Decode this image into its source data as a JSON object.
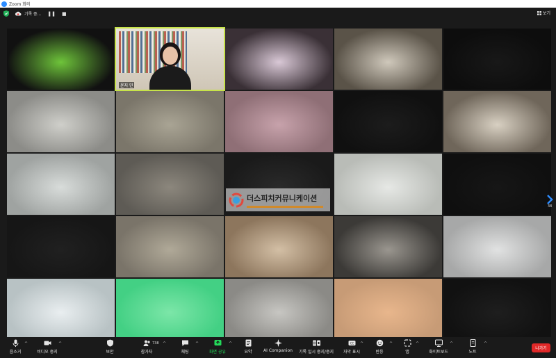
{
  "window": {
    "title": "Zoom 회의"
  },
  "topbar": {
    "recording_label": "기록 중...",
    "pause_glyph": "❚❚",
    "stop_glyph": "■",
    "view_label": "보기"
  },
  "participants": [
    {
      "name": "",
      "bg": "#111111",
      "accent": "#6ec43a"
    },
    {
      "name": "윤지 민",
      "bg": "#d6d1c7",
      "accent": "#1b1b1b",
      "speaker": true
    },
    {
      "name": "",
      "bg": "#3a3036",
      "accent": "#d9c8d6"
    },
    {
      "name": "",
      "bg": "#5a5348",
      "accent": "#cfc8bb"
    },
    {
      "name": "",
      "bg": "#0d0d0d",
      "accent": "#181818"
    },
    {
      "name": "",
      "bg": "#8c8c88",
      "accent": "#cfcfca"
    },
    {
      "name": "",
      "bg": "#7b766a",
      "accent": "#a9a494"
    },
    {
      "name": "",
      "bg": "#8f6f76",
      "accent": "#c7a2ab"
    },
    {
      "name": "",
      "bg": "#101010",
      "accent": "#1c1c1c"
    },
    {
      "name": "",
      "bg": "#6f665a",
      "accent": "#d8d0c2"
    },
    {
      "name": "",
      "bg": "#9fa3a1",
      "accent": "#d8dcda"
    },
    {
      "name": "",
      "bg": "#5e5b55",
      "accent": "#8c877d"
    },
    {
      "name": "",
      "bg": "#1a1a1a",
      "accent": "#2a2a2a"
    },
    {
      "name": "",
      "bg": "#b9bcb7",
      "accent": "#e6e8e5"
    },
    {
      "name": "",
      "bg": "#0f0f0f",
      "accent": "#161616"
    },
    {
      "name": "",
      "bg": "#161616",
      "accent": "#202020"
    },
    {
      "name": "",
      "bg": "#7a7469",
      "accent": "#b0a998"
    },
    {
      "name": "",
      "bg": "#8d765d",
      "accent": "#d3bfa5"
    },
    {
      "name": "",
      "bg": "#3c3a37",
      "accent": "#9a968f"
    },
    {
      "name": "",
      "bg": "#a7a8a8",
      "accent": "#e1e2e2"
    },
    {
      "name": "",
      "bg": "#b8c2c4",
      "accent": "#e9eef0"
    },
    {
      "name": "",
      "bg": "#43d084",
      "accent": "#7ce6a8"
    },
    {
      "name": "",
      "bg": "#8b8a86",
      "accent": "#c7c6c2"
    },
    {
      "name": "",
      "bg": "#c79b76",
      "accent": "#e8b68c"
    },
    {
      "name": "",
      "bg": "#111111",
      "accent": "#1e1e1e"
    }
  ],
  "watermark": {
    "text": "더스피치커뮤니케이션"
  },
  "side_page": {
    "count": "38"
  },
  "toolbar": {
    "mute": "음소거",
    "video": "비디오 중지",
    "security": "보안",
    "participants": "참가자",
    "participants_count": "738",
    "chat": "채팅",
    "share": "화면 공유",
    "summary": "요약",
    "ai": "AI Companion",
    "record": "기록 일시 중지/중지",
    "cc": "자막 표시",
    "reactions": "반응",
    "apps": "앱",
    "whiteboard": "화이트보드",
    "notes": "노트",
    "leave": "나가기"
  },
  "colors": {
    "accent": "#2d8cff",
    "share_green": "#23d959",
    "leave_red": "#e02828",
    "speaker_outline": "#c7e34a"
  }
}
